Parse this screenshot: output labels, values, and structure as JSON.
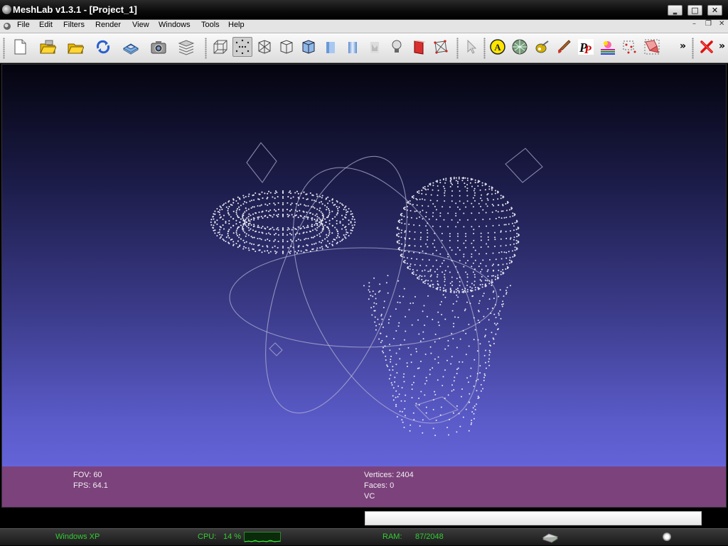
{
  "window": {
    "title": "MeshLab v1.3.1 - [Project_1]",
    "minimize_glyph": "‗",
    "maximize_glyph": "□",
    "close_glyph": "✕"
  },
  "menu": {
    "items": [
      "File",
      "Edit",
      "Filters",
      "Render",
      "View",
      "Windows",
      "Tools",
      "Help"
    ],
    "mdi_minimize": "–",
    "mdi_restore": "❐",
    "mdi_close": "✕"
  },
  "toolbar": {
    "groups": [
      [
        "new-document-icon",
        "open-project-icon",
        "import-mesh-icon",
        "reload-icon",
        "save-icon",
        "snapshot-icon",
        "layers-icon"
      ],
      [
        "bounding-box-icon",
        "points-icon",
        "wireframe-icon",
        "hidden-lines-icon",
        "flat-lines-icon",
        "flat-icon",
        "smooth-icon",
        "texture-icon",
        "light-icon",
        "double-side-lighting-icon",
        "backface-culling-icon"
      ],
      [
        "select-tool-icon"
      ],
      [
        "annotate-icon",
        "measure-icon",
        "align-icon",
        "paint-icon",
        "pick-points-icon",
        "color-correction-icon",
        "select-vertices-icon",
        "select-faces-icon"
      ],
      [
        "delete-icon"
      ]
    ],
    "overflow_glyph": "»"
  },
  "viewport": {
    "fov_label": "FOV: 60",
    "fps_label": "FPS:   64.1",
    "vertices_label": "Vertices: 2404",
    "faces_label": "Faces: 0",
    "mode_label": "VC",
    "background_top": "#04040f",
    "background_bottom": "#6c6ce6",
    "info_color": "#7c427c"
  },
  "progress": {
    "value": 0
  },
  "taskbar": {
    "os_label": "Windows XP",
    "cpu_label": "CPU:",
    "cpu_value": "14 %",
    "ram_label": "RAM:",
    "ram_value": "87/2048",
    "accent": "#33cc33"
  }
}
